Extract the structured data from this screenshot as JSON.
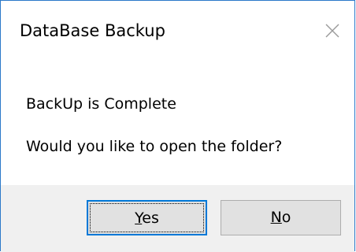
{
  "window": {
    "title": "DataBase Backup",
    "close_icon": "close-icon"
  },
  "message": {
    "line1": "BackUp is Complete",
    "line2": "Would you like to open the folder?"
  },
  "buttons": {
    "yes": {
      "accel": "Y",
      "rest": "es",
      "focused": true
    },
    "no": {
      "accel": "N",
      "rest": "o",
      "focused": false
    }
  },
  "colors": {
    "window_border": "#2b79c9",
    "button_bar": "#f0f0f0",
    "button_face": "#e1e1e1",
    "focus_border": "#0078d7"
  }
}
